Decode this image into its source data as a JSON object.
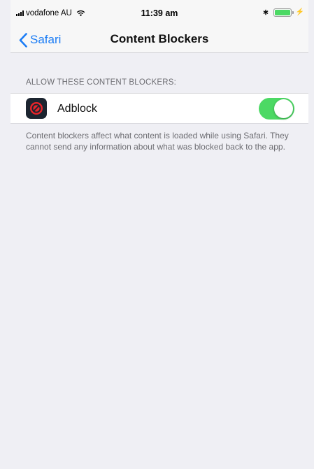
{
  "status_bar": {
    "carrier": "vodafone AU",
    "time": "11:39 am",
    "battery_color": "#4cd964"
  },
  "nav": {
    "back_label": "Safari",
    "title": "Content Blockers",
    "accent_color": "#1a7cf5"
  },
  "section": {
    "header": "ALLOW THESE CONTENT BLOCKERS:",
    "items": [
      {
        "label": "Adblock",
        "icon": "adblock-icon",
        "enabled": true
      }
    ],
    "footer": "Content blockers affect what content is loaded while using Safari. They cannot send any information about what was blocked back to the app."
  },
  "colors": {
    "background": "#efeff4",
    "toggle_on": "#4cd964"
  }
}
